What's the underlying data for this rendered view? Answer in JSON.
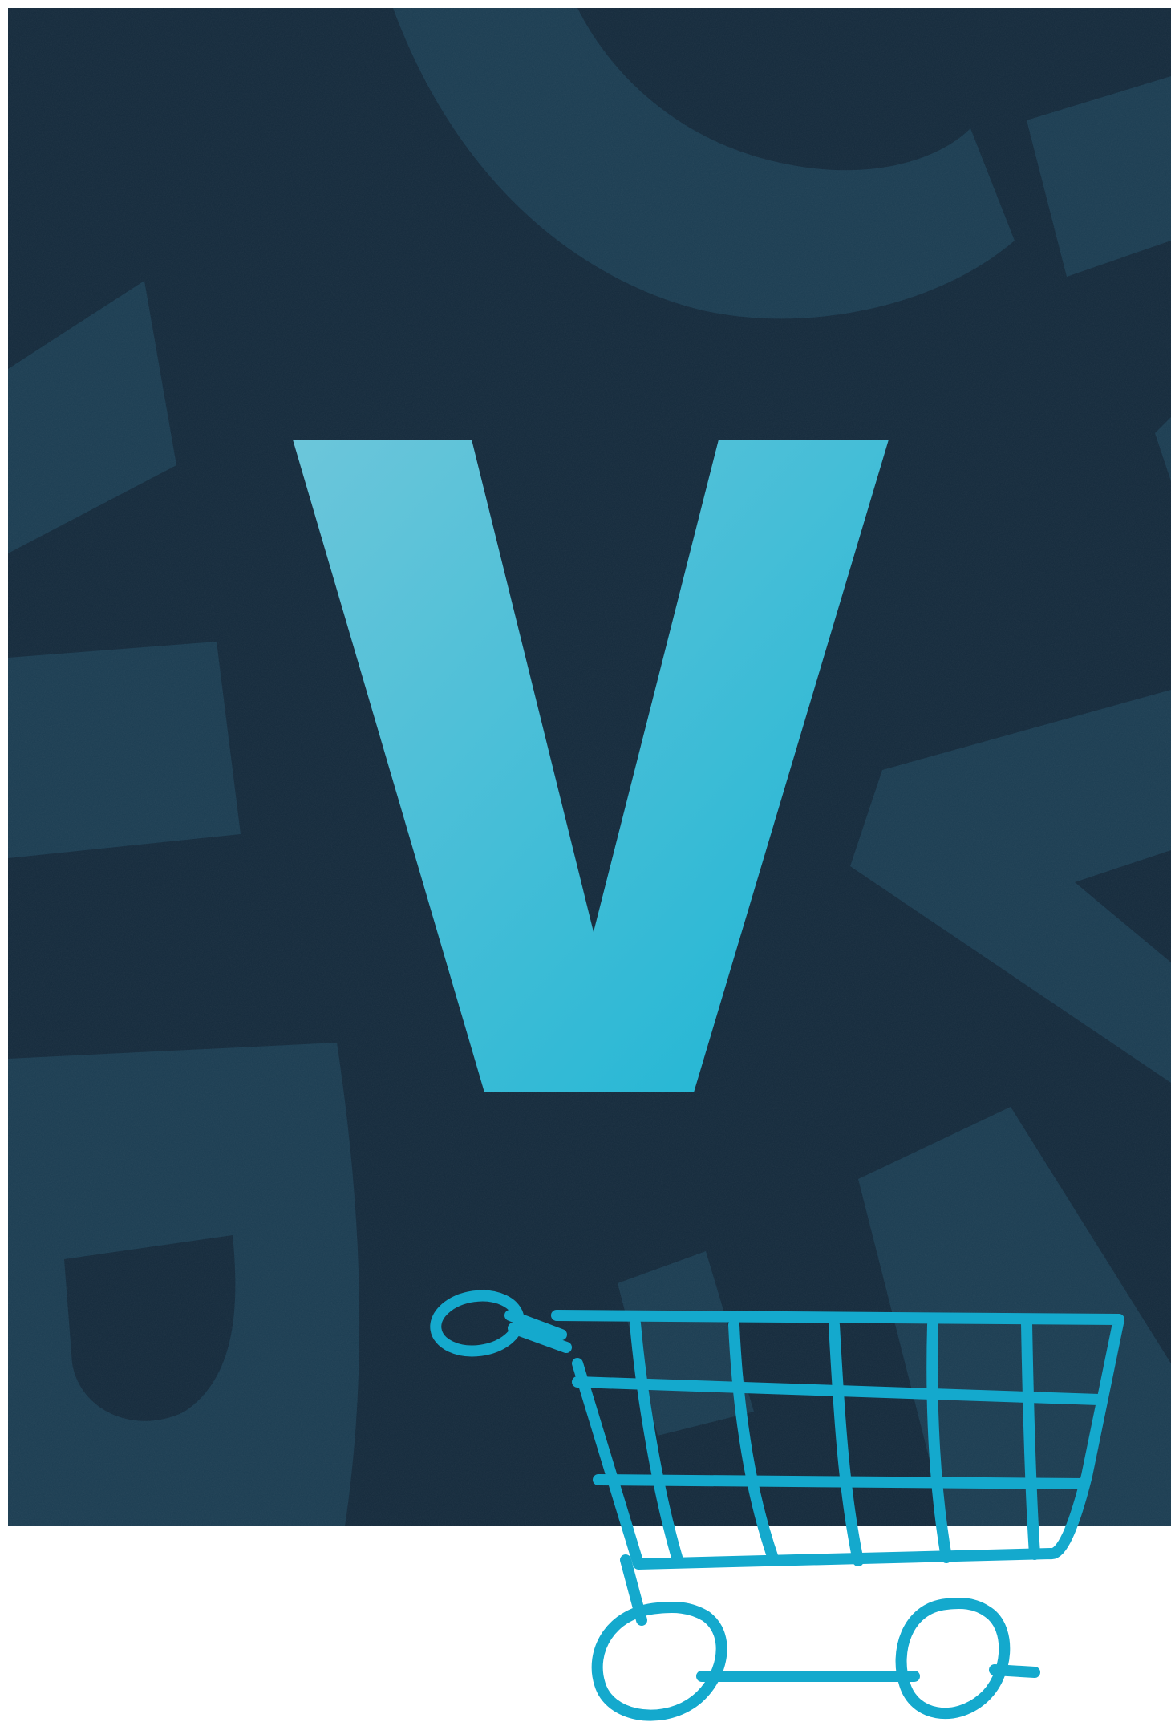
{
  "poster": {
    "letter": "V",
    "icon": "shopping-cart-icon",
    "colors": {
      "panel": "#142a3c",
      "panel_shapes": "#1b3d52",
      "letter_light": "#6cc6da",
      "letter_dark": "#1bb5d4",
      "cart_stroke": "#14a9cd",
      "background": "#ffffff"
    }
  }
}
